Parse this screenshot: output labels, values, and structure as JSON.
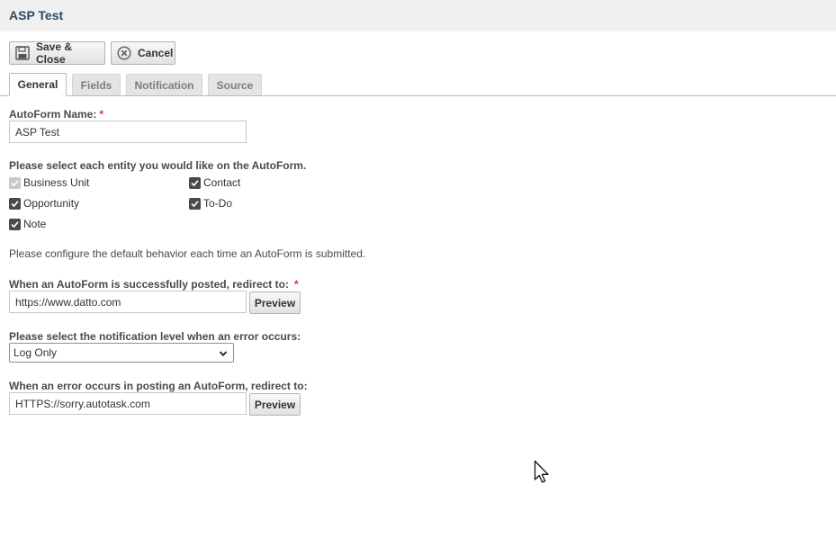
{
  "window": {
    "title": "ASP Test"
  },
  "toolbar": {
    "save_close_label": "Save & Close",
    "cancel_label": "Cancel"
  },
  "tabs": [
    {
      "label": "General",
      "active": true
    },
    {
      "label": "Fields",
      "active": false
    },
    {
      "label": "Notification",
      "active": false
    },
    {
      "label": "Source",
      "active": false
    }
  ],
  "form": {
    "name_label": "AutoForm Name:",
    "required_mark": "*",
    "name_value": "ASP Test",
    "entities_label": "Please select each entity you would like on the AutoForm.",
    "entities": [
      {
        "label": "Business Unit",
        "checked": true,
        "disabled": true
      },
      {
        "label": "Contact",
        "checked": true,
        "disabled": false
      },
      {
        "label": "Opportunity",
        "checked": true,
        "disabled": false
      },
      {
        "label": "To-Do",
        "checked": true,
        "disabled": false
      },
      {
        "label": "Note",
        "checked": true,
        "disabled": false
      }
    ],
    "configure_text": "Please configure the default behavior each time an AutoForm is submitted.",
    "success_label": "When an AutoForm is successfully posted, redirect to:",
    "success_value": "https://www.datto.com",
    "preview_label": "Preview",
    "notify_label": "Please select the notification level when an error occurs:",
    "notify_value": "Log Only",
    "error_label": "When an error occurs in posting an AutoForm, redirect to:",
    "error_value": "HTTPS://sorry.autotask.com"
  },
  "colors": {
    "title": "#2c4a62",
    "required": "#d0342c",
    "titlebar_bg": "#f0f0f0"
  },
  "icons": {
    "save": "floppy-disk-icon",
    "cancel": "cancel-circle-icon",
    "checkbox": "checkmark-icon",
    "dropdown": "chevron-down-icon",
    "cursor": "mouse-pointer-icon"
  }
}
